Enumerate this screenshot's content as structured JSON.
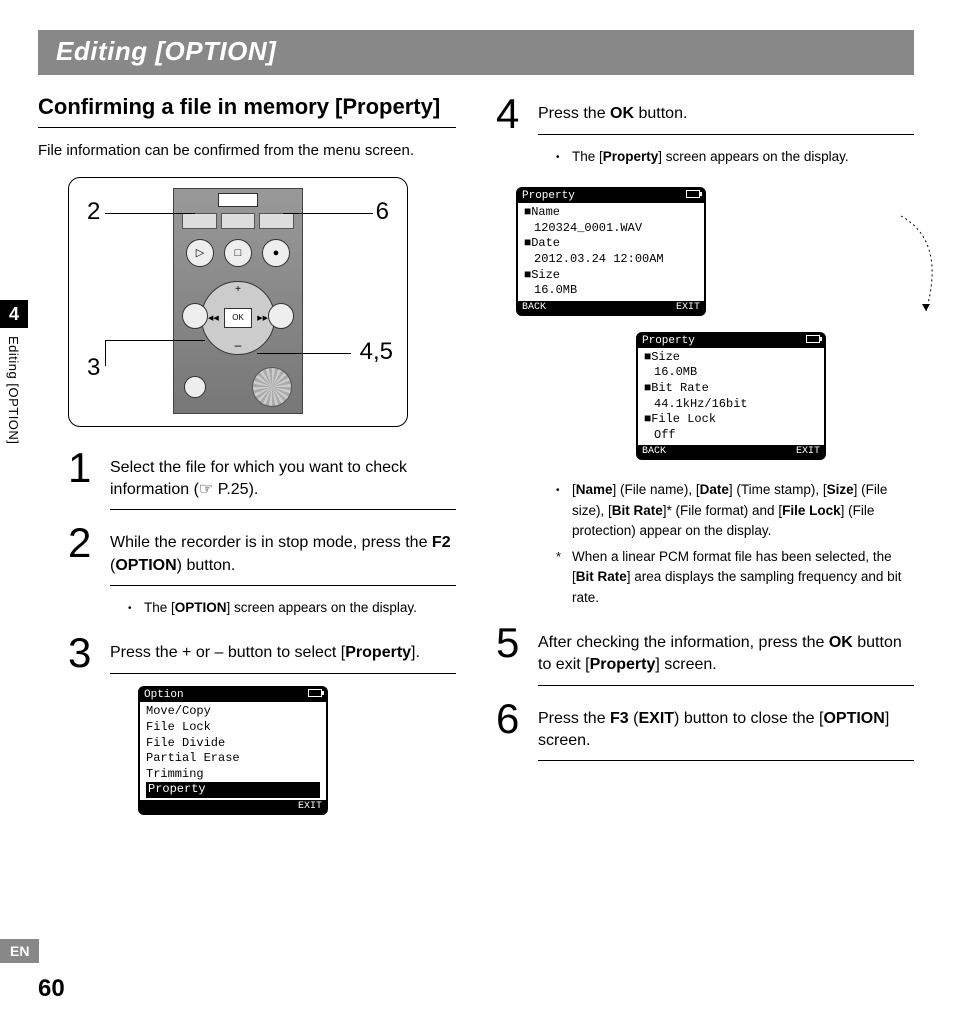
{
  "header": "Editing [OPTION]",
  "sidebar": {
    "chapter_num": "4",
    "chapter_label": "Editing [OPTION]",
    "lang": "EN"
  },
  "page_number": "60",
  "left": {
    "heading": "Confirming a file in memory [Property]",
    "intro": "File information can be confirmed from the menu screen.",
    "callouts": {
      "c2": "2",
      "c3": "3",
      "c45": "4,5",
      "c6": "6"
    },
    "device": {
      "ok": "OK",
      "play": "▷",
      "stop": "□",
      "rec": "●",
      "prev": "I◀◀",
      "next": "▶▶I",
      "plus": "+",
      "minus": "–"
    },
    "step1": {
      "num": "1",
      "text_a": "Select the file for which you want to check information (☞ P.25)."
    },
    "step2": {
      "num": "2",
      "text_a": "While the recorder is in stop mode, press the ",
      "f2": "F2",
      "opt": "OPTION",
      "text_b": ") button."
    },
    "note2": {
      "a": "The [",
      "b": "OPTION",
      "c": "] screen appears on the display."
    },
    "step3": {
      "num": "3",
      "text_a": "Press the + or – button to select [",
      "prop": "Property",
      "text_b": "]."
    },
    "lcd_option": {
      "title": "Option",
      "items": [
        "Move/Copy",
        "File Lock",
        "File Divide",
        "Partial Erase",
        "Trimming"
      ],
      "selected": "Property",
      "exit": "EXIT"
    }
  },
  "right": {
    "step4": {
      "num": "4",
      "text_a": "Press the ",
      "ok": "OK",
      "text_b": " button."
    },
    "note4": {
      "a": "The [",
      "b": "Property",
      "c": "] screen appears on the display."
    },
    "lcd_prop1": {
      "title": "Property",
      "rows": [
        [
          "Name",
          "120324_0001.WAV"
        ],
        [
          "Date",
          "2012.03.24 12:00AM"
        ],
        [
          "Size",
          "16.0MB"
        ]
      ],
      "back": "BACK",
      "exit": "EXIT"
    },
    "lcd_prop2": {
      "title": "Property",
      "rows": [
        [
          "Size",
          "16.0MB"
        ],
        [
          "Bit Rate",
          "44.1kHz/16bit"
        ],
        [
          "File Lock",
          "Off"
        ]
      ],
      "back": "BACK",
      "exit": "EXIT"
    },
    "note_fields": {
      "a": "[",
      "name": "Name",
      "b": "] (File name), [",
      "date": "Date",
      "c": "] (Time stamp), [",
      "size": "Size",
      "d": "] (File size), [",
      "bitrate": "Bit Rate",
      "e": "]* (File format) and [",
      "filelock": "File Lock",
      "f": "] (File protection) appear on the display."
    },
    "note_ast": "When a linear PCM format file has been selected, the [Bit Rate] area displays the sampling frequency and bit rate.",
    "note_ast_pre": "When a linear PCM format file has been selected, the [",
    "note_ast_b": "Bit Rate",
    "note_ast_post": "] area displays the sampling frequency and bit rate.",
    "step5": {
      "num": "5",
      "text_a": "After checking the information, press the ",
      "ok": "OK",
      "text_b": " button to exit [",
      "prop": "Property",
      "text_c": "] screen."
    },
    "step6": {
      "num": "6",
      "text_a": "Press the ",
      "f3": "F3",
      "exit": "EXIT",
      "text_b": ") button to close the [",
      "opt": "OPTION",
      "text_c": "] screen."
    }
  }
}
